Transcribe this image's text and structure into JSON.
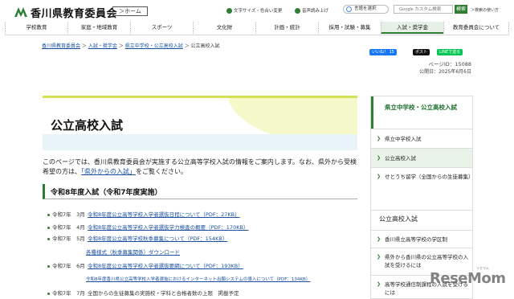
{
  "header": {
    "site_title": "香川県教育委員会",
    "home_label": "＞ホーム",
    "util": [
      "文字サイズ・色合い変更",
      "音声読み上げ"
    ],
    "lang_label": "言語を選択",
    "search_placeholder": "Google カスタム検索",
    "search_button": "検索",
    "search_help": "＞検索の使い方"
  },
  "nav": [
    "学校教育",
    "家庭・地域教育",
    "スポーツ",
    "文化財",
    "計画・統計",
    "採用・試験・募集",
    "入試・奨学金",
    "教育委員会について"
  ],
  "nav_active": "入試・奨学金",
  "breadcrumb": [
    "香川県教育委員会",
    "入試・奨学金",
    "県立中学校・公立高校入試",
    "公立高校入試"
  ],
  "social": {
    "like": "いいね！ 15",
    "post": "ポスト",
    "line": "LINEで送る"
  },
  "page_id": "ページID：15088",
  "pub_date": "公開日：2025年6月6日",
  "title": "公立高校入試",
  "intro_1": "このページでは、香川県教育委員会が実施する公立高等学校入試の情報をご案内します。なお、県外から受検希望の方は、",
  "intro_link": "「県外からの入試」",
  "intro_2": "をご覧ください。",
  "section_title": "令和8年度入試（令和7年度実施）",
  "news": [
    {
      "date": "令和7年　3月",
      "text": "令和8年度公立高等学校入学者選抜日程について（PDF：27KB）",
      "link": true
    },
    {
      "date": "令和7年　4月",
      "text": "令和8年度公立高等学校入学者選抜学力検査の概要（PDF：170KB）",
      "link": true
    },
    {
      "date": "令和7年　5月",
      "text": "令和8年度公立高等学校秋季募集について（PDF：154KB）",
      "link": true
    },
    {
      "date": "",
      "text": "各種様式（秋季募集関係）ダウンロード",
      "link": true
    },
    {
      "date": "令和7年　6月",
      "text": "令和8年度公立高等学校入学者選抜要綱について（PDF：193KB）",
      "link": true
    },
    {
      "date": "",
      "text": "令和8年度香川県公立高等学校入学者選抜におけるインターネット出願システムの導入について（PDF：134KB）",
      "link": true
    },
    {
      "date": "令和7年　7月",
      "text": "全国からの生徒募集の実施校・学科と合格者数の上限　掲載予定",
      "link": false
    }
  ],
  "side1": {
    "heading": "県立中学校・公立高校入試",
    "items": [
      "県立中学校入試",
      "公立高校入試",
      "せとうち留学（全国からの生徒募集）"
    ],
    "current": "公立高校入試"
  },
  "side2": {
    "heading": "公立高校入試",
    "items": [
      "香川県立高等学校の学区制",
      "県外から香川県の公立高等学校の入試を受けるには",
      "高等学校通信制課程の入試を受けるには"
    ]
  },
  "watermark": "ReseMom",
  "watermark_small": "リセマム",
  "colors": {
    "accent": "#2e7d32",
    "link": "#1a4fa0"
  }
}
